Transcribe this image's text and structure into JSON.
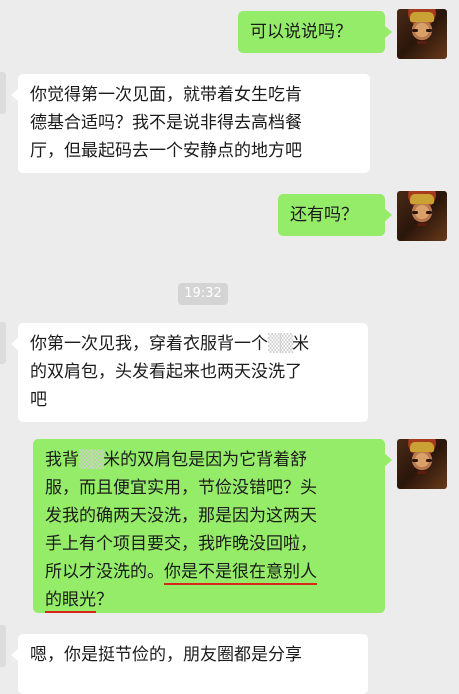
{
  "messages": [
    {
      "side": "right",
      "lines": [
        "可以说说吗？"
      ]
    },
    {
      "side": "left",
      "lines": [
        "你觉得第一次见面，就带着女生吃肯",
        "德基合适吗？我不是说非得去高档餐",
        "厅，但最起码去一个安静点的地方吧"
      ]
    },
    {
      "side": "right",
      "lines": [
        "还有吗？"
      ]
    },
    {
      "timestamp": "19:32"
    },
    {
      "side": "left",
      "lines": [
        "你第一次见我，穿着衣服背一个",
        "米",
        "的双肩包，头发看起来也两天没洗了",
        "吧"
      ]
    },
    {
      "side": "right",
      "lines": [
        "我背",
        "米的双肩包是因为它背着舒",
        "服，而且便宜实用，节俭没错吧？头",
        "发我的确两天没洗，那是因为这两天",
        "手上有个项目要交，我昨晚没回啦，",
        "所以才没洗的。",
        "你是不是很在意别人",
        "的眼光",
        "？"
      ]
    },
    {
      "side": "left",
      "lines": [
        "嗯，你是挺节俭的，朋友圈都是分享"
      ]
    }
  ]
}
